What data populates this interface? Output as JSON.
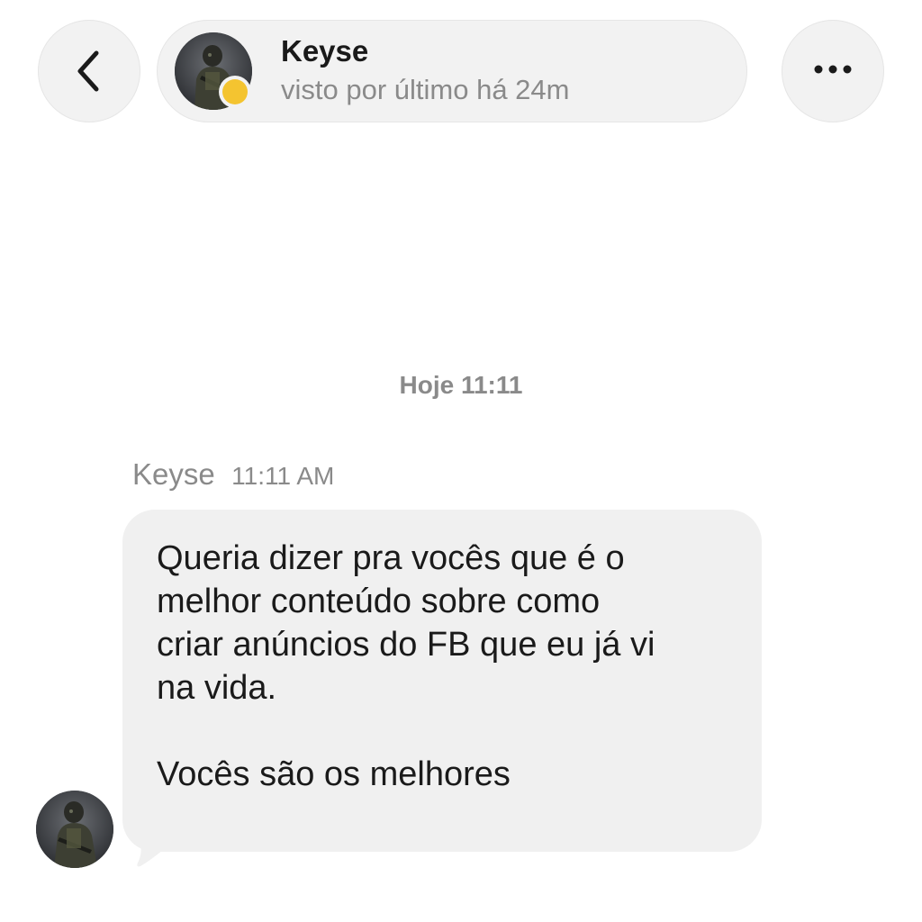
{
  "header": {
    "back_icon": "chevron-left-icon",
    "contact_name": "Keyse",
    "contact_status": "visto por último há 24m",
    "presence_color": "#f4c430",
    "more_icon": "more-horizontal-icon"
  },
  "conversation": {
    "date_divider": "Hoje 11:11",
    "message": {
      "sender": "Keyse",
      "time": "11:11 AM",
      "lines": [
        "Queria dizer pra vocês que é o",
        "melhor conteúdo sobre como",
        "criar anúncios do FB que eu já vi",
        "na vida.",
        "",
        "Vocês são os melhores"
      ],
      "bubble_color": "#f0f0f0"
    }
  }
}
